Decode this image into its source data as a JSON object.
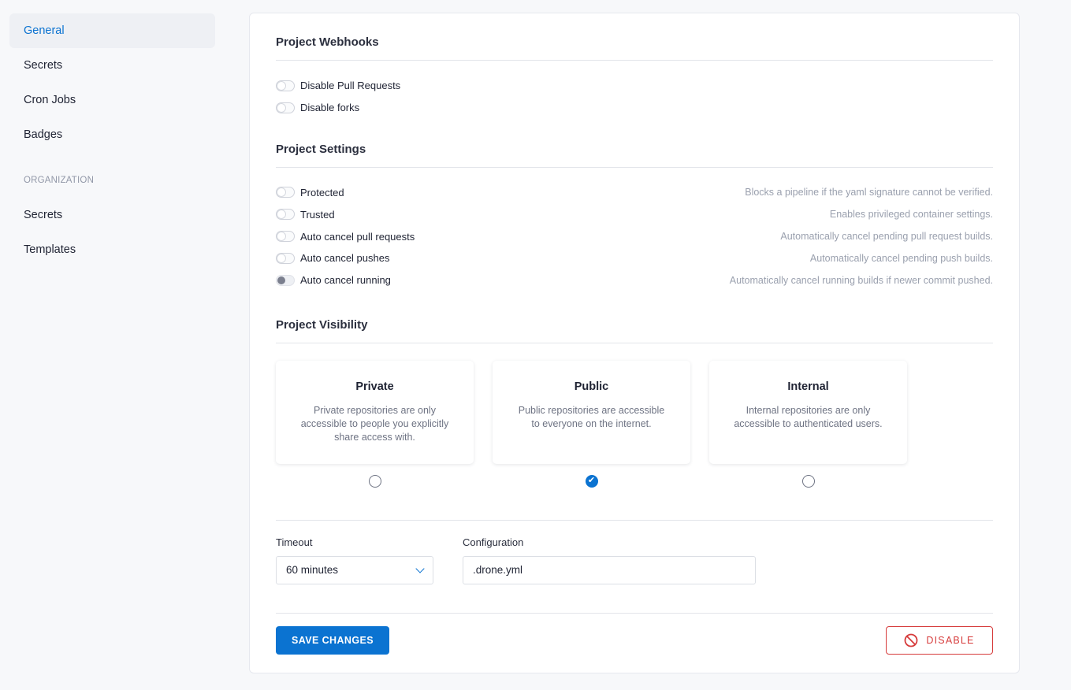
{
  "sidebar": {
    "items": [
      {
        "label": "General",
        "active": true
      },
      {
        "label": "Secrets"
      },
      {
        "label": "Cron Jobs"
      },
      {
        "label": "Badges"
      }
    ],
    "section_label": "ORGANIZATION",
    "org_items": [
      {
        "label": "Secrets"
      },
      {
        "label": "Templates"
      }
    ]
  },
  "webhooks": {
    "title": "Project Webhooks",
    "toggles": [
      {
        "label": "Disable Pull Requests",
        "on": false
      },
      {
        "label": "Disable forks",
        "on": false
      }
    ]
  },
  "settings": {
    "title": "Project Settings",
    "toggles": [
      {
        "label": "Protected",
        "desc": "Blocks a pipeline if the yaml signature cannot be verified.",
        "on": false
      },
      {
        "label": "Trusted",
        "desc": "Enables privileged container settings.",
        "on": false
      },
      {
        "label": "Auto cancel pull requests",
        "desc": "Automatically cancel pending pull request builds.",
        "on": false
      },
      {
        "label": "Auto cancel pushes",
        "desc": "Automatically cancel pending push builds.",
        "on": false
      },
      {
        "label": "Auto cancel running",
        "desc": "Automatically cancel running builds if newer commit pushed.",
        "on": false,
        "disabled": true
      }
    ]
  },
  "visibility": {
    "title": "Project Visibility",
    "options": [
      {
        "title": "Private",
        "desc": "Private repositories are only accessible to people you explicitly share access with.",
        "checked": false
      },
      {
        "title": "Public",
        "desc": "Public repositories are accessible to everyone on the internet.",
        "checked": true
      },
      {
        "title": "Internal",
        "desc": "Internal repositories are only accessible to authenticated users.",
        "checked": false
      }
    ]
  },
  "form": {
    "timeout_label": "Timeout",
    "timeout_value": "60 minutes",
    "config_label": "Configuration",
    "config_value": ".drone.yml"
  },
  "actions": {
    "save_label": "SAVE CHANGES",
    "disable_label": "DISABLE"
  },
  "colors": {
    "accent": "#0b73d1",
    "danger": "#d63b3b"
  }
}
